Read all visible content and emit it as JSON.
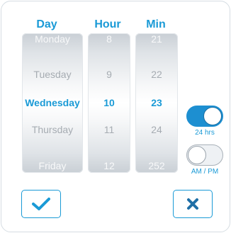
{
  "headers": {
    "day": "Day",
    "hour": "Hour",
    "min": "Min"
  },
  "day_column": {
    "items": [
      "Monday",
      "Tuesday",
      "Wednesday",
      "Thursday",
      "Friday"
    ],
    "selected": "Wednesday"
  },
  "hour_column": {
    "items": [
      "8",
      "9",
      "10",
      "11",
      "12"
    ],
    "selected": "10"
  },
  "min_column": {
    "items": [
      "21",
      "22",
      "23",
      "24",
      "252"
    ],
    "selected": "23"
  },
  "toggles": {
    "h24": {
      "label": "24 hrs",
      "on": true
    },
    "ampm": {
      "label": "AM / PM",
      "on": false
    }
  },
  "buttons": {
    "confirm_icon": "checkmark-icon",
    "cancel_icon": "close-x-icon"
  },
  "colors": {
    "accent": "#1a9ad6",
    "toggle_on": "#1d8fd1",
    "cancel_icon": "#1f6fa6"
  }
}
